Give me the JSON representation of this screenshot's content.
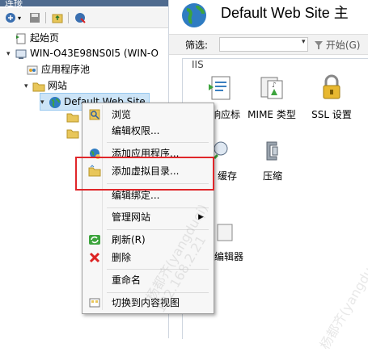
{
  "left_pane": {
    "header_title": "连接",
    "tree": [
      {
        "label": "起始页"
      },
      {
        "label": "WIN-O43E98NS0I5 (WIN-O"
      },
      {
        "label": "应用程序池"
      },
      {
        "label": "网站"
      },
      {
        "label": "Default Web Site"
      }
    ]
  },
  "main": {
    "title": "Default Web Site 主",
    "filter_label": "筛选:",
    "start_label": "开始(G)",
    "section_label": "IIS",
    "features": [
      {
        "label": "响应标"
      },
      {
        "label": "MIME 类型"
      },
      {
        "label": "SSL 设置"
      },
      {
        "label": "缓存"
      },
      {
        "label": "压缩"
      },
      {
        "label": "编辑器"
      }
    ]
  },
  "context_menu": {
    "items": [
      {
        "label": "浏览",
        "icon": "browse-icon"
      },
      {
        "label": "编辑权限...",
        "icon": ""
      },
      {
        "label": "添加应用程序...",
        "icon": "add-application-icon"
      },
      {
        "label": "添加虚拟目录...",
        "icon": "add-virtual-directory-icon"
      },
      {
        "label": "编辑绑定...",
        "icon": ""
      },
      {
        "label": "管理网站",
        "icon": "",
        "submenu": "▶"
      },
      {
        "label": "刷新(R)",
        "icon": "refresh-icon"
      },
      {
        "label": "删除",
        "icon": "delete-icon"
      },
      {
        "label": "重命名",
        "icon": ""
      },
      {
        "label": "切换到内容视图",
        "icon": "content-view-icon"
      }
    ]
  },
  "highlight_color": "#e0262a",
  "watermarks": [
    "杨都齐(yangduqi)",
    "192.168.2.21"
  ]
}
